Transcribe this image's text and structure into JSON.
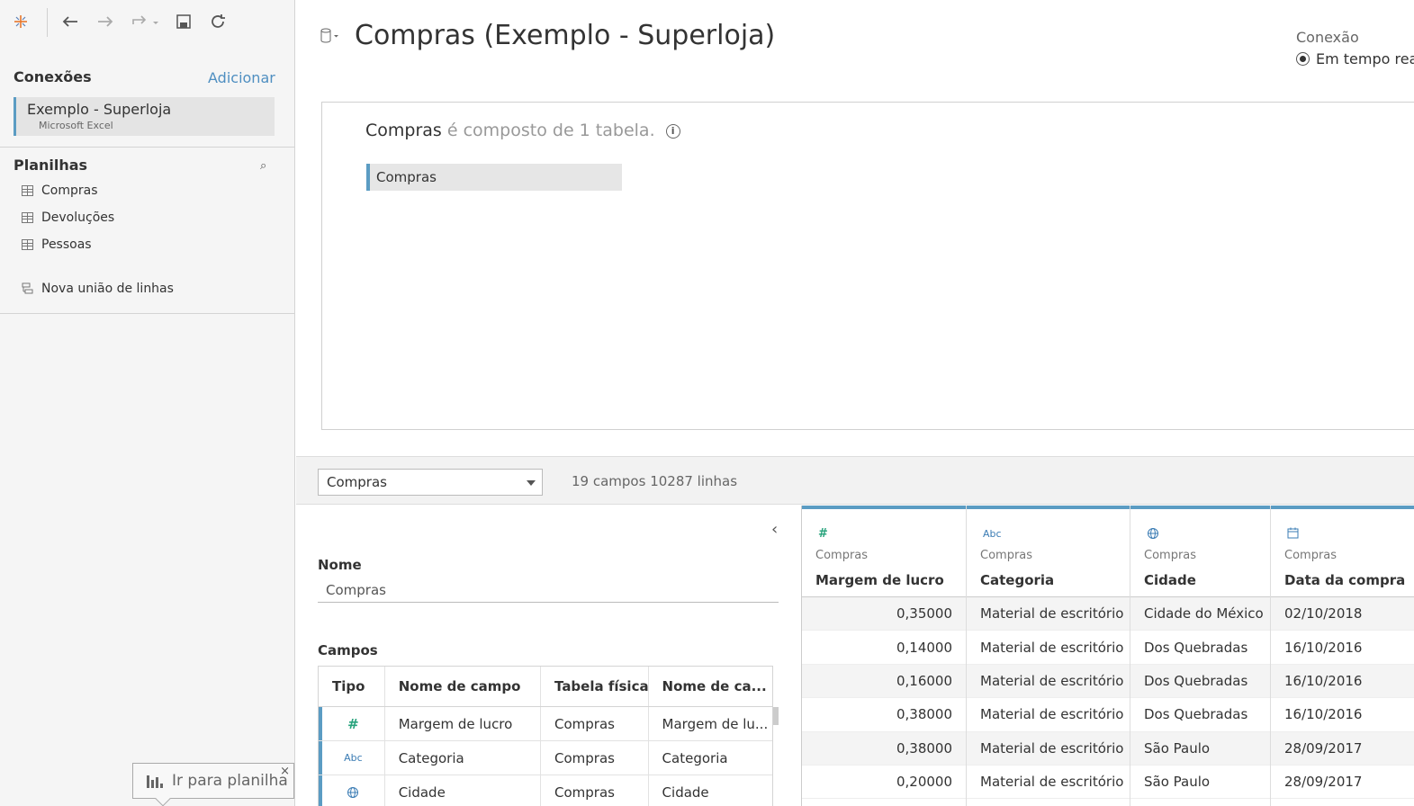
{
  "toolbar": {
    "icons": [
      "tableau-logo-icon",
      "undo-icon",
      "redo-icon",
      "replay-icon",
      "save-icon",
      "refresh-icon"
    ]
  },
  "sidebar": {
    "connections_title": "Conexões",
    "add_label": "Adicionar",
    "connection": {
      "name": "Exemplo - Superloja",
      "type": "Microsoft Excel"
    },
    "sheets_title": "Planilhas",
    "sheets": [
      "Compras",
      "Devoluções",
      "Pessoas"
    ],
    "new_union": "Nova união de linhas"
  },
  "header": {
    "title": "Compras (Exemplo - Superloja)",
    "connection_label": "Conexão",
    "live_option": "Em tempo real"
  },
  "canvas": {
    "table_name": "Compras",
    "composition_text": "é composto de 1 tabela.",
    "info_glyph": "i",
    "tables": [
      "Compras"
    ]
  },
  "strip": {
    "selected_table": "Compras",
    "counts": "19 campos 10287 linhas"
  },
  "metadata": {
    "collapse_glyph": "‹",
    "name_label": "Nome",
    "name_value": "Compras",
    "fields_label": "Campos",
    "columns": [
      "Tipo",
      "Nome de campo",
      "Tabela física",
      "Nome de ca..."
    ],
    "rows": [
      {
        "type_icon": "#",
        "field": "Margem de lucro",
        "table": "Compras",
        "remote": "Margem de lu..."
      },
      {
        "type_icon": "Abc",
        "field": "Categoria",
        "table": "Compras",
        "remote": "Categoria"
      },
      {
        "type_icon": "globe",
        "field": "Cidade",
        "table": "Compras",
        "remote": "Cidade"
      }
    ]
  },
  "grid": {
    "columns": [
      {
        "icon": "#",
        "source": "Compras",
        "name": "Margem de lucro",
        "numeric": true
      },
      {
        "icon": "Abc",
        "source": "Compras",
        "name": "Categoria",
        "numeric": false
      },
      {
        "icon": "globe",
        "source": "Compras",
        "name": "Cidade",
        "numeric": false
      },
      {
        "icon": "calendar",
        "source": "Compras",
        "name": "Data da compra",
        "numeric": false
      }
    ],
    "rows": [
      [
        "0,35000",
        "Material de escritório",
        "Cidade do México",
        "02/10/2018"
      ],
      [
        "0,14000",
        "Material de escritório",
        "Dos Quebradas",
        "16/10/2016"
      ],
      [
        "0,16000",
        "Material de escritório",
        "Dos Quebradas",
        "16/10/2016"
      ],
      [
        "0,38000",
        "Material de escritório",
        "Dos Quebradas",
        "16/10/2016"
      ],
      [
        "0,38000",
        "Material de escritório",
        "São Paulo",
        "28/09/2017"
      ],
      [
        "0,20000",
        "Material de escritório",
        "São Paulo",
        "28/09/2017"
      ]
    ]
  },
  "tooltip": {
    "label": "Ir para planilha",
    "close": "×"
  },
  "colors": {
    "accent": "#5b9cc3",
    "link": "#4f8fc1",
    "number_icon": "#27a37c",
    "string_icon": "#3b7cb4"
  }
}
